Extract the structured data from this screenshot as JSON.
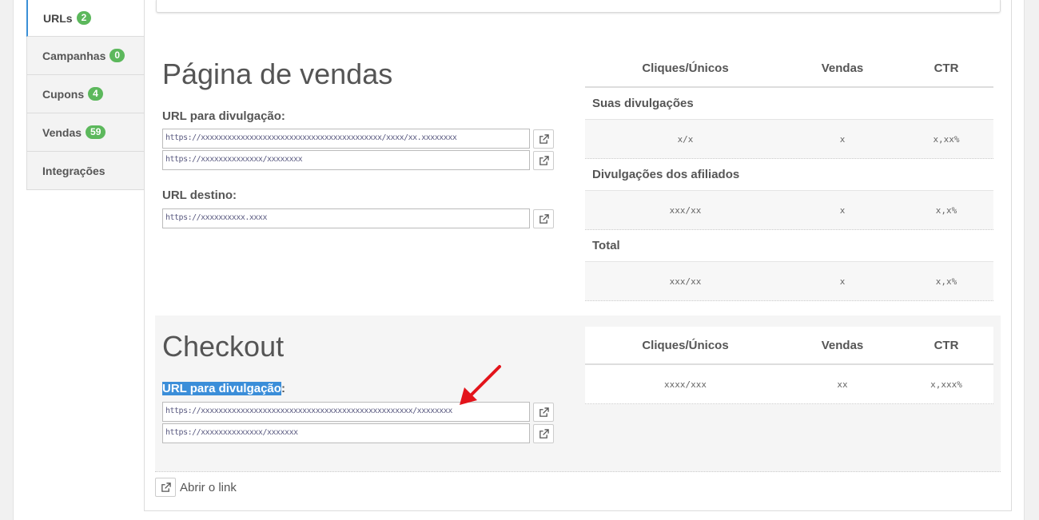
{
  "sidebar": {
    "items": [
      {
        "label": "URLs",
        "badge": "2",
        "active": true
      },
      {
        "label": "Campanhas",
        "badge": "0"
      },
      {
        "label": "Cupons",
        "badge": "4"
      },
      {
        "label": "Vendas",
        "badge": "59"
      },
      {
        "label": "Integrações",
        "badge": null
      }
    ]
  },
  "sales_page": {
    "title": "Página de vendas",
    "promo_label": "URL para divulgação:",
    "promo_urls": [
      "https://xxxxxxxxxxxxxxxxxxxxxxxxxxxxxxxxxxxxxxxxx/xxxx/xx.xxxxxxxx",
      "https://xxxxxxxxxxxxxx/xxxxxxxx"
    ],
    "dest_label": "URL destino:",
    "dest_url": "https://xxxxxxxxxx.xxxx"
  },
  "sales_stats": {
    "headers": [
      "Cliques/Únicos",
      "Vendas",
      "CTR"
    ],
    "groups": [
      {
        "label": "Suas divulgações",
        "values": [
          "x/x",
          "x",
          "x,xx%"
        ]
      },
      {
        "label": "Divulgações dos afiliados",
        "values": [
          "xxx/xx",
          "x",
          "x,x%"
        ]
      },
      {
        "label": "Total",
        "values": [
          "xxx/xx",
          "x",
          "x,x%"
        ]
      }
    ]
  },
  "checkout": {
    "title": "Checkout",
    "promo_label_highlight": "URL para divulgação",
    "promo_label_suffix": ":",
    "promo_urls": [
      "https://xxxxxxxxxxxxxxxxxxxxxxxxxxxxxxxxxxxxxxxxxxxxxxxx/xxxxxxxx",
      "https://xxxxxxxxxxxxxx/xxxxxxx"
    ]
  },
  "checkout_stats": {
    "headers": [
      "Cliques/Únicos",
      "Vendas",
      "CTR"
    ],
    "values": [
      "xxxx/xxx",
      "xx",
      "x,xxx%"
    ]
  },
  "footer": {
    "open_link_label": "Abrir o link"
  },
  "colors": {
    "badge": "#5cb85c",
    "highlight": "#3b8ed9",
    "arrow": "#e3141b"
  }
}
